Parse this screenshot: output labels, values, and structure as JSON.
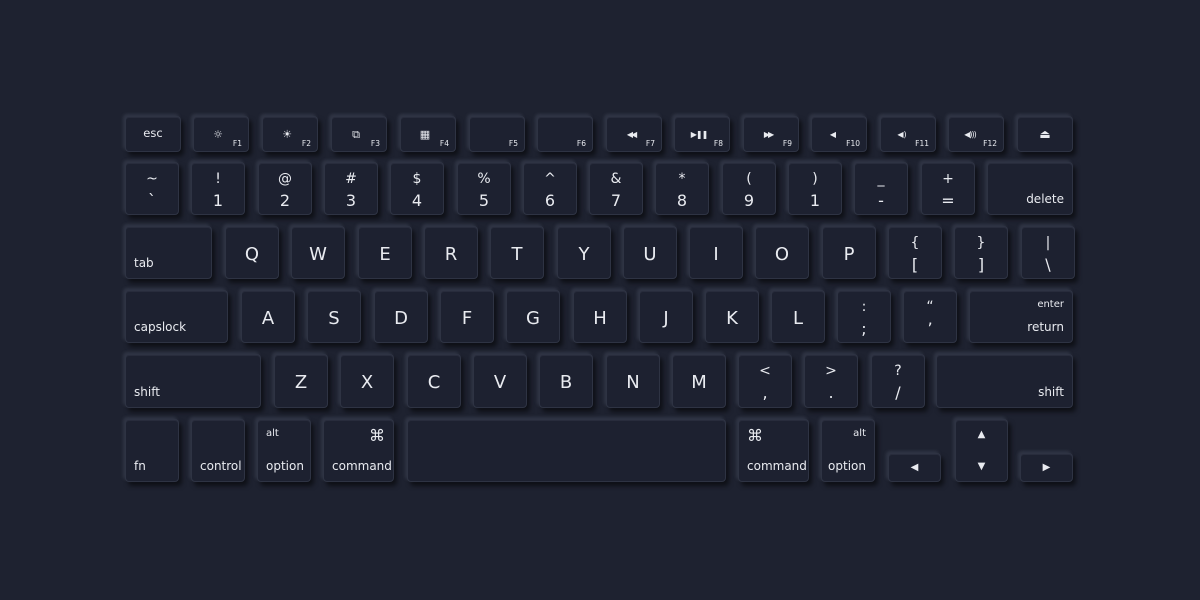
{
  "theme": {
    "background": "#1e2230",
    "key_color": "#1d2130",
    "label_color": "#e9ebf0"
  },
  "function_row": [
    {
      "name": "esc",
      "label": "esc"
    },
    {
      "name": "f1",
      "icon": "brightness-down-icon",
      "glyph": "☼",
      "fn": "F1"
    },
    {
      "name": "f2",
      "icon": "brightness-up-icon",
      "glyph": "☀",
      "fn": "F2"
    },
    {
      "name": "f3",
      "icon": "mission-control-icon",
      "glyph": "⧉",
      "fn": "F3"
    },
    {
      "name": "f4",
      "icon": "launchpad-icon",
      "glyph": "▦",
      "fn": "F4"
    },
    {
      "name": "f5",
      "glyph": "",
      "fn": "F5"
    },
    {
      "name": "f6",
      "glyph": "",
      "fn": "F6"
    },
    {
      "name": "f7",
      "icon": "rewind-icon",
      "glyph": "◀◀",
      "fn": "F7"
    },
    {
      "name": "f8",
      "icon": "play-pause-icon",
      "glyph": "▶❚❚",
      "fn": "F8"
    },
    {
      "name": "f9",
      "icon": "fast-forward-icon",
      "glyph": "▶▶",
      "fn": "F9"
    },
    {
      "name": "f10",
      "icon": "mute-icon",
      "glyph": "◀",
      "fn": "F10"
    },
    {
      "name": "f11",
      "icon": "volume-down-icon",
      "glyph": "◀)",
      "fn": "F11"
    },
    {
      "name": "f12",
      "icon": "volume-up-icon",
      "glyph": "◀)))",
      "fn": "F12"
    },
    {
      "name": "eject",
      "icon": "eject-icon",
      "glyph": "⏏"
    }
  ],
  "number_row": [
    {
      "top": "~",
      "bottom": "`"
    },
    {
      "top": "!",
      "bottom": "1"
    },
    {
      "top": "@",
      "bottom": "2"
    },
    {
      "top": "#",
      "bottom": "3"
    },
    {
      "top": "$",
      "bottom": "4"
    },
    {
      "top": "%",
      "bottom": "5"
    },
    {
      "top": "^",
      "bottom": "6"
    },
    {
      "top": "&",
      "bottom": "7"
    },
    {
      "top": "*",
      "bottom": "8"
    },
    {
      "top": "(",
      "bottom": "9"
    },
    {
      "top": ")",
      "bottom": "1"
    },
    {
      "top": "_",
      "bottom": "-"
    },
    {
      "top": "+",
      "bottom": "="
    }
  ],
  "delete_label": "delete",
  "tab_label": "tab",
  "qwerty_row": [
    "Q",
    "W",
    "E",
    "R",
    "T",
    "Y",
    "U",
    "I",
    "O",
    "P"
  ],
  "qwerty_symbols": [
    {
      "top": "{",
      "bottom": "["
    },
    {
      "top": "}",
      "bottom": "]"
    },
    {
      "top": "|",
      "bottom": "\\"
    }
  ],
  "capslock_label": "capslock",
  "home_row": [
    "A",
    "S",
    "D",
    "F",
    "G",
    "H",
    "J",
    "K",
    "L"
  ],
  "home_symbols": [
    {
      "top": ":",
      "bottom": ";"
    },
    {
      "top": "“",
      "bottom": "’"
    }
  ],
  "return_key": {
    "top": "enter",
    "bottom": "return"
  },
  "shift_label": "shift",
  "bottom_row_letters": [
    "Z",
    "X",
    "C",
    "V",
    "B",
    "N",
    "M"
  ],
  "bottom_symbols": [
    {
      "top": "<",
      "bottom": ","
    },
    {
      "top": ">",
      "bottom": "."
    },
    {
      "top": "?",
      "bottom": "/"
    }
  ],
  "modifiers": {
    "fn": "fn",
    "control": "control",
    "alt": "alt",
    "option": "option",
    "command_symbol": "⌘",
    "command": "command"
  },
  "arrows": {
    "up": "▲",
    "down": "▼",
    "left": "◀",
    "right": "▶"
  }
}
